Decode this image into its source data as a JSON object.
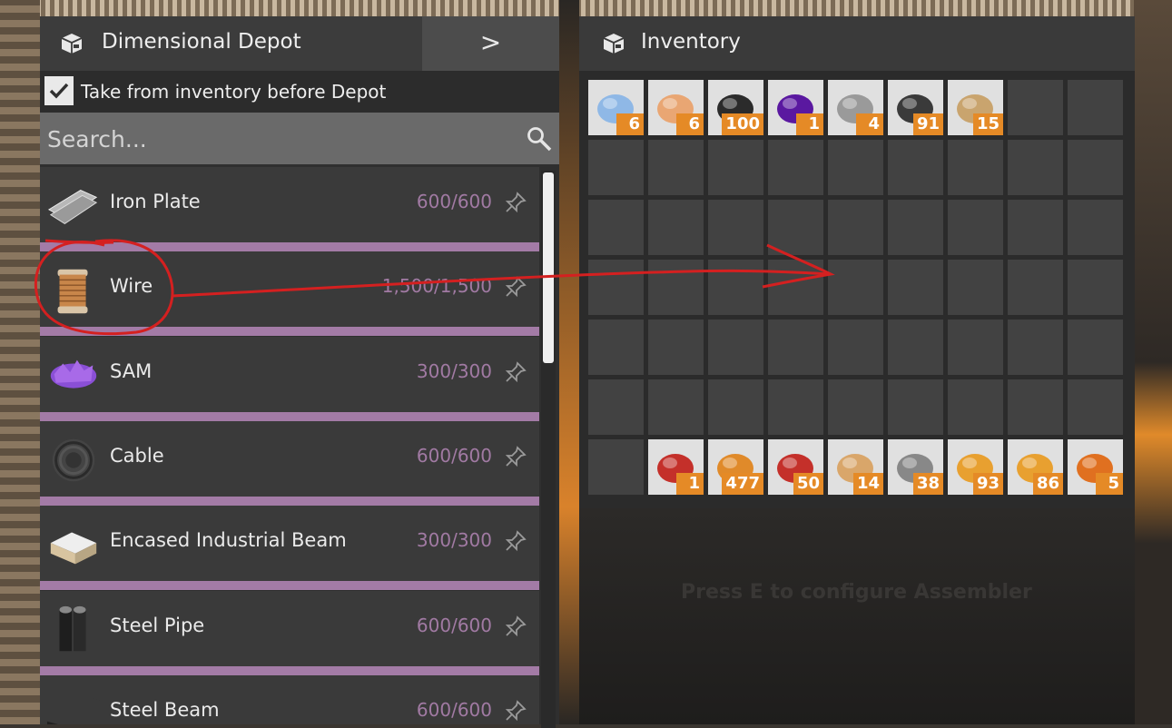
{
  "depot": {
    "title": "Dimensional Depot",
    "arrow": ">",
    "take_label": "Take from inventory before Depot",
    "take_checked": true,
    "search_placeholder": "Search...",
    "items": [
      {
        "name": "Iron Plate",
        "count": "600/600",
        "icon": "iron-plate-icon",
        "color": "#b8b8b8"
      },
      {
        "name": "Wire",
        "count": "1,500/1,500",
        "icon": "wire-spool-icon",
        "color": "#c8864a"
      },
      {
        "name": "SAM",
        "count": "300/300",
        "icon": "sam-crystal-icon",
        "color": "#8a4fd6"
      },
      {
        "name": "Cable",
        "count": "600/600",
        "icon": "cable-coil-icon",
        "color": "#2a2a2a"
      },
      {
        "name": "Encased Industrial Beam",
        "count": "300/300",
        "icon": "encased-beam-icon",
        "color": "#d8c4a0"
      },
      {
        "name": "Steel Pipe",
        "count": "600/600",
        "icon": "steel-pipe-icon",
        "color": "#1e1e1e"
      },
      {
        "name": "Steel Beam",
        "count": "600/600",
        "icon": "steel-beam-icon",
        "color": "#3a3a3a"
      }
    ]
  },
  "inventory": {
    "title": "Inventory",
    "columns": 9,
    "rows": 7,
    "slots": [
      {
        "index": 0,
        "qty": "6",
        "icon": "quartz-crystal-icon",
        "color": "#8fb8e6"
      },
      {
        "index": 1,
        "qty": "6",
        "icon": "raw-quartz-icon",
        "color": "#e9a673"
      },
      {
        "index": 2,
        "qty": "100",
        "icon": "coal-icon",
        "color": "#2b2b2b"
      },
      {
        "index": 3,
        "qty": "1",
        "icon": "sam-ore-icon",
        "color": "#5a18a0"
      },
      {
        "index": 4,
        "qty": "4",
        "icon": "limestone-icon",
        "color": "#9a9a9a"
      },
      {
        "index": 5,
        "qty": "91",
        "icon": "leaves-icon",
        "color": "#3a3a3a"
      },
      {
        "index": 6,
        "qty": "15",
        "icon": "wood-icon",
        "color": "#c9a46e"
      },
      {
        "index": 55,
        "qty": "1",
        "icon": "nobelisk-icon",
        "color": "#c4302a"
      },
      {
        "index": 56,
        "qty": "477",
        "icon": "rifle-ammo-icon",
        "color": "#e08a2a"
      },
      {
        "index": 57,
        "qty": "50",
        "icon": "explosive-rebar-icon",
        "color": "#c4302a"
      },
      {
        "index": 58,
        "qty": "14",
        "icon": "storage-container-icon",
        "color": "#d9a66a"
      },
      {
        "index": 59,
        "qty": "38",
        "icon": "miner-icon",
        "color": "#888888"
      },
      {
        "index": 60,
        "qty": "93",
        "icon": "vehicle-icon",
        "color": "#e8a030"
      },
      {
        "index": 61,
        "qty": "86",
        "icon": "assembler-icon",
        "color": "#e8a030"
      },
      {
        "index": 62,
        "qty": "5",
        "icon": "battery-icon",
        "color": "#e07020"
      }
    ]
  },
  "hint": "Press E to configure Assembler",
  "colors": {
    "accent": "#e58a26",
    "bar": "#a37ba6",
    "count": "#a17aa3",
    "annotation": "#d42020"
  }
}
